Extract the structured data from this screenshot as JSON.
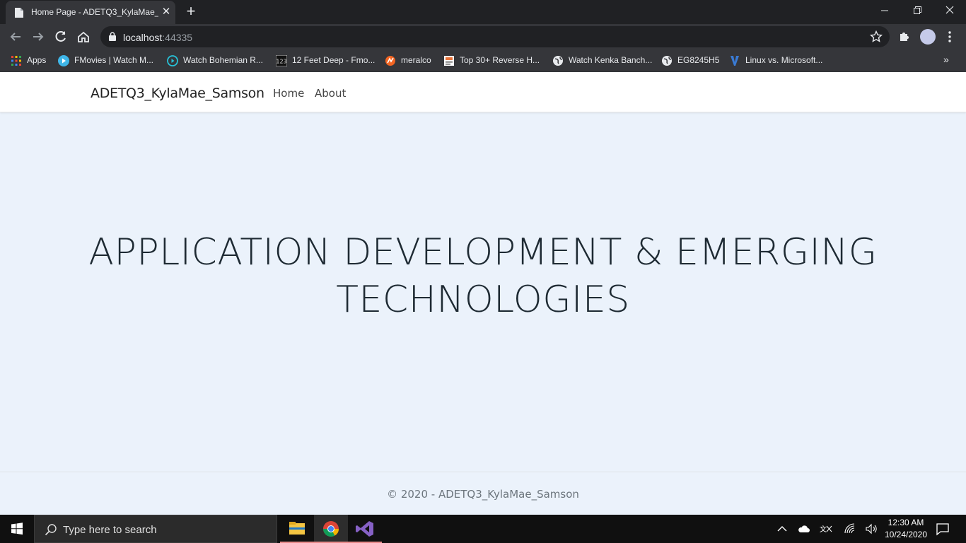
{
  "browser": {
    "tab_title": "Home Page - ADETQ3_KylaMae_S",
    "url_host": "localhost",
    "url_port": ":44335"
  },
  "bookmarks": [
    {
      "label": "Apps",
      "icon": "apps-grid-icon"
    },
    {
      "label": "FMovies | Watch M...",
      "icon": "play-icon"
    },
    {
      "label": "Watch Bohemian R...",
      "icon": "play-circle-icon"
    },
    {
      "label": "12 Feet Deep - Fmo...",
      "icon": "123-icon"
    },
    {
      "label": "meralco",
      "icon": "meralco-icon"
    },
    {
      "label": "Top 30+ Reverse H...",
      "icon": "page-icon"
    },
    {
      "label": "Watch Kenka Banch...",
      "icon": "globe-icon"
    },
    {
      "label": "EG8245H5",
      "icon": "globe-icon"
    },
    {
      "label": "Linux vs. Microsoft...",
      "icon": "v-icon"
    }
  ],
  "site": {
    "brand": "ADETQ3_KylaMae_Samson",
    "nav": {
      "home": "Home",
      "about": "About"
    },
    "hero_line1": "APPLICATION DEVELOPMENT & EMERGING",
    "hero_line2": "TECHNOLOGIES",
    "footer": "© 2020 - ADETQ3_KylaMae_Samson"
  },
  "taskbar": {
    "search_placeholder": "Type here to search",
    "time": "12:30 AM",
    "date": "10/24/2020"
  }
}
